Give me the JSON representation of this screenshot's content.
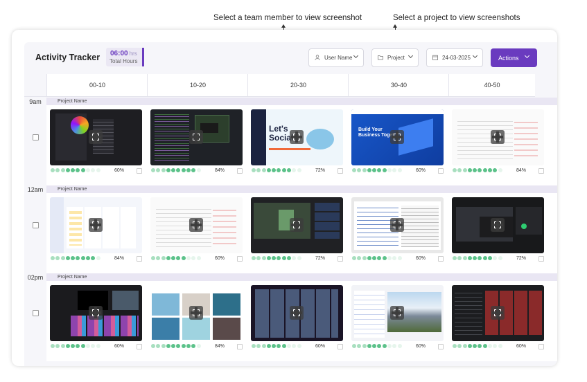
{
  "callouts": {
    "team_member": "Select a team member to view screenshot",
    "project": "Select a project to view screenshots"
  },
  "header": {
    "title": "Activity Tracker",
    "hours_value": "06:00",
    "hours_unit": "hrs",
    "hours_label": "Total Hours"
  },
  "controls": {
    "user_name": "User Name",
    "project": "Project",
    "date": "24-03-2025",
    "actions": "Actions"
  },
  "columns": [
    "00-10",
    "10-20",
    "20-30",
    "30-40",
    "40-50"
  ],
  "rows": [
    {
      "time": "9am",
      "project_name": "Project Name",
      "cells": [
        {
          "pct": "60%",
          "filled": 7,
          "theme": "dark"
        },
        {
          "pct": "84%",
          "filled": 9,
          "theme": "code"
        },
        {
          "pct": "72%",
          "filled": 8,
          "theme": "social"
        },
        {
          "pct": "60%",
          "filled": 7,
          "theme": "blue"
        },
        {
          "pct": "84%",
          "filled": 9,
          "theme": "light"
        }
      ]
    },
    {
      "time": "12am",
      "project_name": "Project Name",
      "cells": [
        {
          "pct": "84%",
          "filled": 9,
          "theme": "board"
        },
        {
          "pct": "60%",
          "filled": 7,
          "theme": "light"
        },
        {
          "pct": "72%",
          "filled": 8,
          "theme": "meeting"
        },
        {
          "pct": "60%",
          "filled": 7,
          "theme": "editor"
        },
        {
          "pct": "72%",
          "filled": 8,
          "theme": "video"
        }
      ]
    },
    {
      "time": "02pm",
      "project_name": "Project Name",
      "cells": [
        {
          "pct": "60%",
          "filled": 7,
          "theme": "premiere"
        },
        {
          "pct": "84%",
          "filled": 9,
          "theme": "gallery"
        },
        {
          "pct": "60%",
          "filled": 7,
          "theme": "mosaic"
        },
        {
          "pct": "60%",
          "filled": 7,
          "theme": "landscape"
        },
        {
          "pct": "60%",
          "filled": 7,
          "theme": "redgrid"
        }
      ]
    }
  ],
  "colors": {
    "accent": "#6a3bbf",
    "dot_filled": "#5cc28a",
    "dot_empty": "#c9ead6",
    "band": "#e9e6f3"
  }
}
